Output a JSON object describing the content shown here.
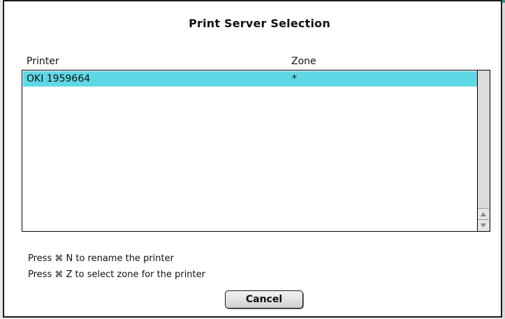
{
  "dialog": {
    "title": "Print Server Selection"
  },
  "list": {
    "columns": {
      "printer": "Printer",
      "zone": "Zone"
    },
    "rows": [
      {
        "printer": "OKI 1959664",
        "zone": "*",
        "selected": true
      }
    ]
  },
  "instructions": {
    "rename": {
      "prefix": "Press",
      "key": "⌘",
      "suffix": "N to rename the printer"
    },
    "zone": {
      "prefix": "Press",
      "key": "⌘",
      "suffix": "Z to select zone for the printer"
    }
  },
  "buttons": {
    "cancel": "Cancel"
  },
  "colors": {
    "selection": "#5fd8e6",
    "accent": "#3d8d8d"
  },
  "icons": {
    "scroll_up": "triangle-up-icon",
    "scroll_down": "triangle-down-icon"
  }
}
